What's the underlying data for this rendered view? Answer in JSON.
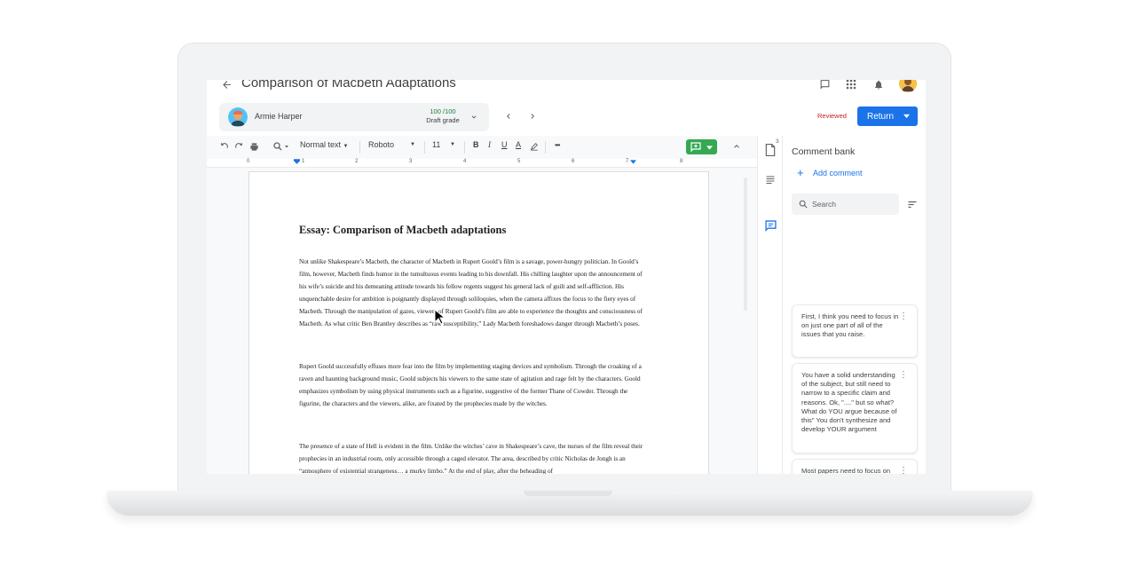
{
  "header": {
    "title": "Comparison of Macbeth Adaptations"
  },
  "student": {
    "name": "Armie Harper",
    "grade": "100 /100",
    "grade_label": "Draft grade"
  },
  "actions": {
    "status": "Reviewed",
    "return_label": "Return"
  },
  "toolbar": {
    "style": "Normal text",
    "font": "Roboto",
    "size": "11",
    "bold": "B",
    "italic": "I",
    "underline": "U",
    "text_color": "A",
    "more": "•••"
  },
  "ruler": [
    "0",
    "1",
    "2",
    "3",
    "4",
    "5",
    "6",
    "7",
    "8"
  ],
  "sidebar": {
    "doc_badge": "3"
  },
  "document": {
    "title": "Essay: Comparison of Macbeth adaptations",
    "paragraphs": [
      "Not unlike Shakespeare’s Macbeth, the character of Macbeth in Rupert Goold’s film is a savage, power-hungry politician. In Goold’s film, however, Macbeth finds humor in the tumultuous events leading to his downfall. His chilling laughter upon the announcement of his wife’s suicide and his demeaning attitude towards his fellow regents suggest his general lack of guilt and self-affliction. His unquenchable desire for ambition is poignantly displayed through soliloquies, when the camera affixes the focus to the fiery eyes of Macbeth. Through the manipulation of gazes, viewers of Rupert Goold’s film are able to experience the thoughts and consciousness of Macbeth. As what critic Ben Brantley describes as “raw susceptibility,” Lady Macbeth foreshadows danger through Macbeth’s poses.",
      "Rupert Goold successfully effuses more fear into the film by implementing staging devices and symbolism. Through the croaking of a raven and haunting background music, Goold subjects his viewers to the same state of agitation and rage felt by the characters. Goold emphasizes symbolism by using physical instruments such as a figurine, suggestive of the former Thane of Cowder. Through the figurine, the characters and the viewers, alike, are fixated by the prophecies made by the witches.",
      "The presence of a state of Hell is evident in the film. Unlike the witches’ cave in Shakespeare’s cave, the nurses of the film reveal their prophecies in an industrial room, only accessible through a caged elevator. The area, described by critic Nicholas de Jongh is an “atmosphere of existential strangeness… a murky limbo.” At the end of play, after the beheading of"
    ]
  },
  "comment_bank": {
    "title": "Comment bank",
    "add_label": "Add comment",
    "search_placeholder": "Search",
    "comments": [
      "First, I think you need to focus in on just one part of all of the issues that you raise.",
      "You have a solid understanding of the subject, but still need to narrow to a specific claim and reasons. Ok, \"....\" but so what? What do YOU argue because of this\" You don't synthesize and develop YOUR argument",
      "Most papers need to focus on just one specific aspect of ... I am still seeing papers that focus on ... Not focusing will keep you from the content and explanation details that you need to develop your analysis."
    ]
  },
  "colors": {
    "accent": "#1a73e8",
    "grade_green": "#188038",
    "reviewed_red": "#c5221f",
    "comment_btn_green": "#34a853"
  }
}
